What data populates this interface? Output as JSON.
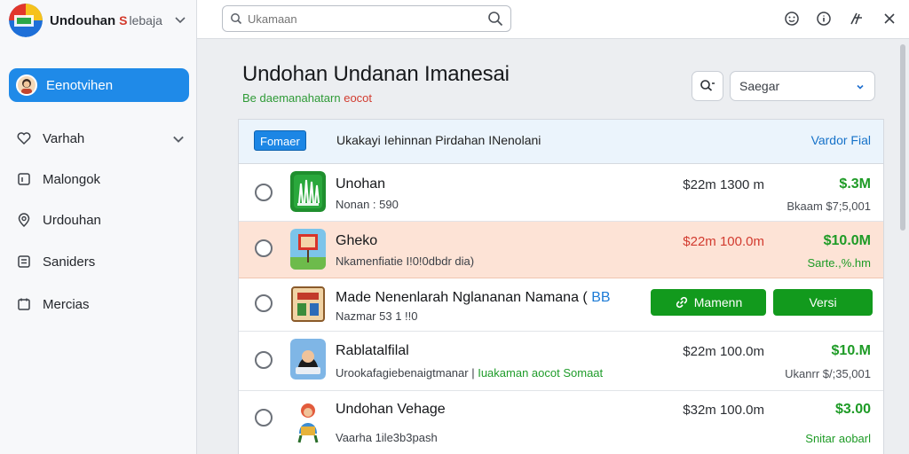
{
  "sidebar": {
    "brand": {
      "title": "Undouhan",
      "badge": "S",
      "subtitle": "lebaja"
    },
    "primary_item": {
      "label": "Eenotvihen"
    },
    "items": [
      {
        "label": "Varhah",
        "icon": "heart-icon",
        "has_chevron": true
      },
      {
        "label": "Malongok",
        "icon": "document-icon",
        "has_chevron": false
      },
      {
        "label": "Urdouhan",
        "icon": "location-pin-icon",
        "has_chevron": false
      },
      {
        "label": "Saniders",
        "icon": "list-box-icon",
        "has_chevron": false
      },
      {
        "label": "Mercias",
        "icon": "clipboard-icon",
        "has_chevron": false
      }
    ]
  },
  "topbar": {
    "search_placeholder": "Ukamaan"
  },
  "main": {
    "title": "Undohan Undanan Imanesai",
    "subtitle_green": "Be daemanahatarn",
    "subtitle_red": "eocot",
    "sort_select": {
      "value": "Saegar"
    }
  },
  "panel": {
    "header": {
      "button_label": "Fomaer",
      "text": "Ukakayi Iehinnan Pirdahan INenolani",
      "link": "Vardor Fial"
    },
    "rows": [
      {
        "title": "Unohan",
        "subtitle": "Nonan : 590",
        "price": "$22m 1300 m",
        "amount": "$.3M",
        "note": "Bkaam $7;5,001"
      },
      {
        "title": "Gheko",
        "subtitle": "Nkamenfiatie I!0!0dbdr dia)",
        "price": "$22m 100.0m",
        "amount": "$10.0M",
        "note": "Sarte.,%.hm"
      },
      {
        "title": "Made Nenenlarah Nglananan Namana (",
        "title_accent": "BB",
        "subtitle": "Nazmar 53 1 !!0",
        "button_primary": "Mamenn",
        "button_secondary": "Versi"
      },
      {
        "title": "Rablatalfilal",
        "subtitle": "Urookafagiebenaigtmanar |",
        "subtitle_accent": "Iuakaman aocot Somaat",
        "price": "$22m 100.0m",
        "amount": "$10.M",
        "note": "Ukanrr $/;35,001"
      },
      {
        "title": "Undohan Vehage",
        "subtitle": "Vaarha 1ile3b3pash",
        "price": "$32m 100.0m",
        "amount": "$3.00",
        "note": "Snitar aobarl"
      }
    ]
  },
  "colors": {
    "accent_blue": "#1f8ae8",
    "success_green": "#129a1d",
    "highlight_row": "#fde3d6",
    "badge_red": "#d33a2c"
  }
}
